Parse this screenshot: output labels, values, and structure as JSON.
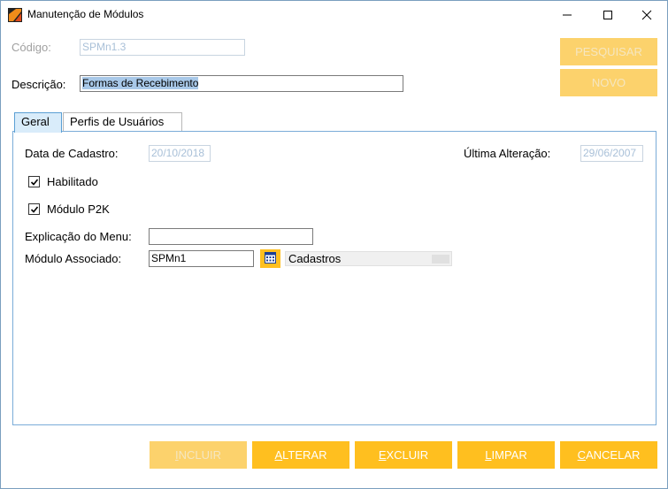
{
  "window": {
    "title": "Manutenção de Módulos"
  },
  "header": {
    "codigo_label": "Código:",
    "codigo_value": "SPMn1.3",
    "descricao_label": "Descrição:",
    "descricao_value": "Formas de Recebimento"
  },
  "side_buttons": {
    "pesquisar": "PESQUISAR",
    "novo": "NOVO"
  },
  "tabs": [
    {
      "label": "Geral"
    },
    {
      "label": "Perfis de Usuários"
    }
  ],
  "geral": {
    "data_cadastro_label": "Data de Cadastro:",
    "data_cadastro_value": "20/10/2018",
    "ultima_alteracao_label": "Última Alteração:",
    "ultima_alteracao_value": "29/06/2007",
    "habilitado_label": "Habilitado",
    "habilitado_checked": true,
    "modulo_p2k_label": "Módulo P2K",
    "modulo_p2k_checked": true,
    "explicacao_label": "Explicação do Menu:",
    "explicacao_value": "",
    "modulo_associado_label": "Módulo Associado:",
    "modulo_associado_value": "SPMn1",
    "modulo_associado_desc": "Cadastros"
  },
  "bottom_buttons": {
    "incluir": {
      "first": "I",
      "rest": "NCLUIR"
    },
    "alterar": {
      "first": "A",
      "rest": "LTERAR"
    },
    "excluir": {
      "first": "E",
      "rest": "XCLUIR"
    },
    "limpar": {
      "first": "L",
      "rest": "IMPAR"
    },
    "cancelar": {
      "first": "C",
      "rest": "ANCELAR"
    }
  },
  "colors": {
    "accent": "#ffbf1f",
    "accent_disabled": "#fcd26c",
    "tab_active": "#d9ecfa"
  }
}
